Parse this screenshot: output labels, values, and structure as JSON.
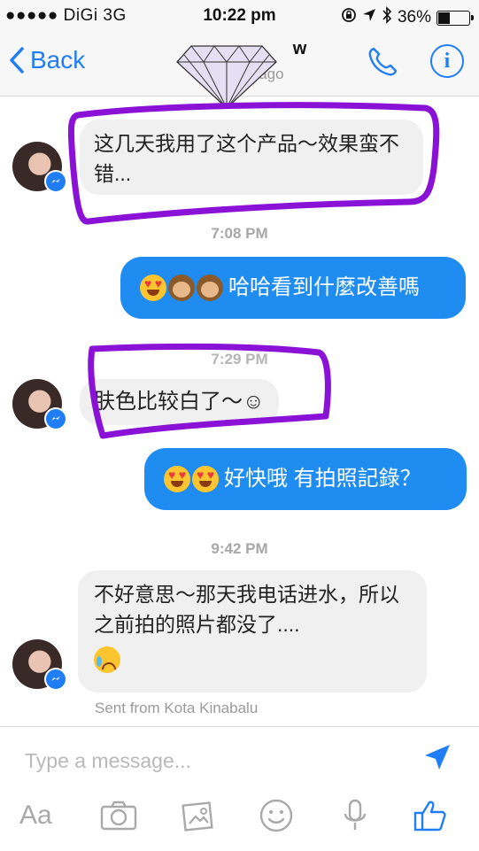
{
  "status_bar": {
    "carrier": "●●●●● DiGi  3G",
    "time": "10:22 pm",
    "battery": "36%",
    "battery_level": 0.36
  },
  "nav": {
    "back_label": "Back",
    "title": "w",
    "subtitle": "A          n ago"
  },
  "colors": {
    "accent": "#1f7ef6",
    "outgoing_bubble": "#1f8cf2",
    "incoming_bubble": "#f0f0f0",
    "highlight_marker": "#8a12d6"
  },
  "messages": [
    {
      "direction": "incoming",
      "text": "这几天我用了这个产品～效果蛮不错..."
    },
    {
      "timestamp": "7:08 PM"
    },
    {
      "direction": "outgoing",
      "text": "哈哈看到什麼改善嗎",
      "emojis": [
        "heart-eyes",
        "see-no-evil-monkey",
        "see-no-evil-monkey"
      ]
    },
    {
      "timestamp": "7:29 PM"
    },
    {
      "direction": "incoming",
      "text": "肤色比较白了～☺"
    },
    {
      "direction": "outgoing",
      "text": "好快哦 有拍照記錄？",
      "emojis": [
        "heart-eyes",
        "heart-eyes"
      ]
    },
    {
      "timestamp": "9:42 PM"
    },
    {
      "direction": "incoming",
      "text": "不好意思～那天我电话进水，所以之前拍的照片都没了....",
      "emojis": [
        "crying-face"
      ]
    }
  ],
  "location_note": "Sent from Kota Kinabalu",
  "composer": {
    "placeholder": "Type a message...",
    "toolbar_aa": "Aa"
  }
}
